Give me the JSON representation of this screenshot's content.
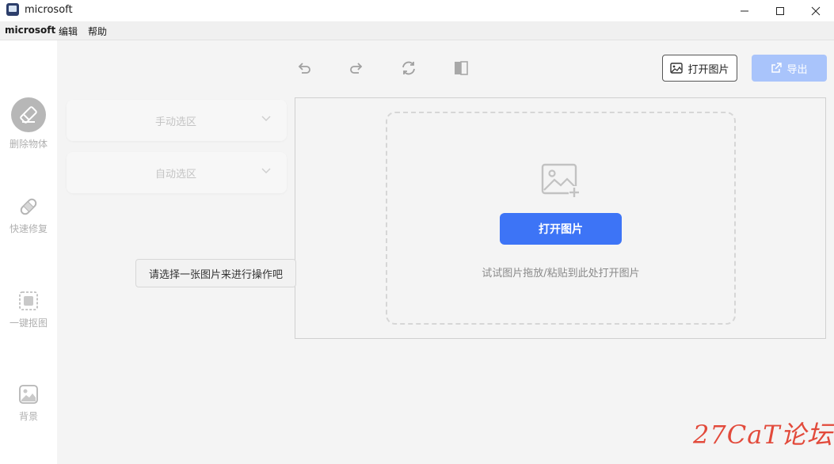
{
  "window": {
    "title": "microsoft"
  },
  "menu": {
    "app": "microsoft",
    "edit": "编辑",
    "help": "帮助"
  },
  "sidebar": {
    "items": [
      {
        "label": "删除物体",
        "icon": "eraser-icon"
      },
      {
        "label": "快速修复",
        "icon": "bandage-icon"
      },
      {
        "label": "一键抠图",
        "icon": "cutout-icon"
      },
      {
        "label": "背景",
        "icon": "image-icon"
      }
    ]
  },
  "toolbar": {
    "undo_icon": "undo-icon",
    "redo_icon": "redo-icon",
    "reset_icon": "refresh-icon",
    "compare_icon": "compare-icon",
    "open_label": "打开图片",
    "export_label": "导出"
  },
  "panels": {
    "manual": "手动选区",
    "auto": "自动选区"
  },
  "tooltip": "请选择一张图片来进行操作吧",
  "dropzone": {
    "button_label": "打开图片",
    "hint": "试试图片拖放/粘贴到此处打开图片"
  },
  "watermark": "27CaT论坛",
  "colors": {
    "primary": "#3d74f6",
    "primary_disabled": "#a9c4fb",
    "watermark": "#e24a3b"
  }
}
